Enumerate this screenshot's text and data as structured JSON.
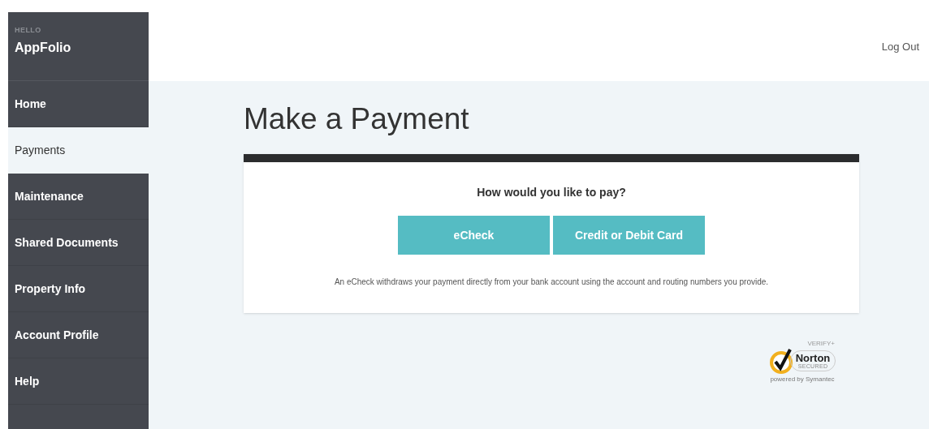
{
  "sidebar": {
    "greeting": "HELLO",
    "user": "AppFolio",
    "items": [
      {
        "label": "Home",
        "selected": false
      },
      {
        "label": "Payments",
        "selected": true
      },
      {
        "label": "Maintenance",
        "selected": false
      },
      {
        "label": "Shared Documents",
        "selected": false
      },
      {
        "label": "Property Info",
        "selected": false
      },
      {
        "label": "Account Profile",
        "selected": false
      },
      {
        "label": "Help",
        "selected": false
      }
    ]
  },
  "header": {
    "logout": "Log Out"
  },
  "page_title": "Make a Payment",
  "payment_card": {
    "question": "How would you like to pay?",
    "options": [
      "eCheck",
      "Credit or Debit Card"
    ],
    "note": "An eCheck withdraws your payment directly from your bank account using the account and routing numbers you provide."
  },
  "badge": {
    "verify": "VERIFY+",
    "brand": "Norton",
    "secured": "SECURED",
    "powered": "powered by Symantec"
  }
}
